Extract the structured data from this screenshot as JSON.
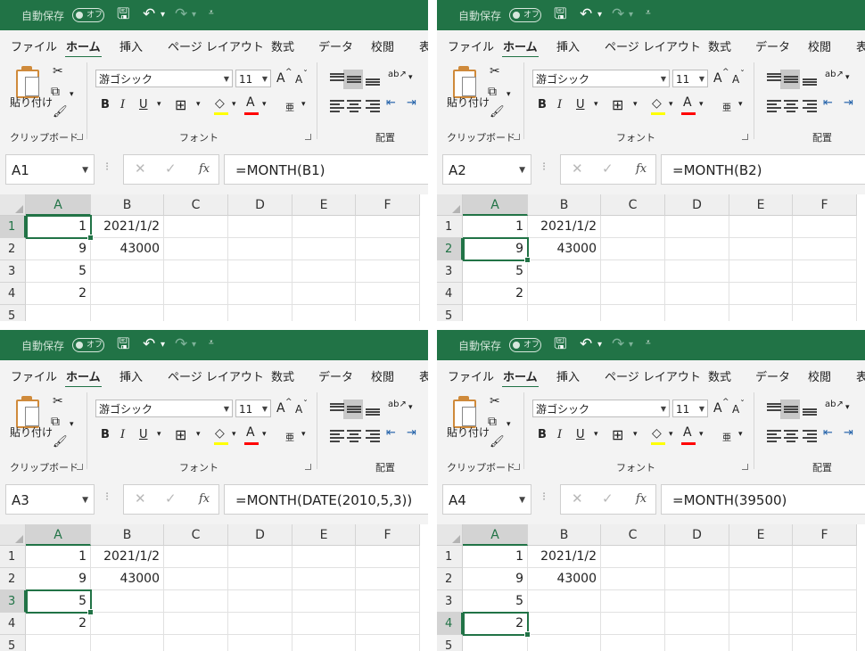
{
  "titlebar": {
    "autosave_label": "自動保存",
    "autosave_state": "オフ"
  },
  "tabs": [
    "ファイル",
    "ホーム",
    "挿入",
    "ページ レイアウト",
    "数式",
    "データ",
    "校閲",
    "表"
  ],
  "ribbon": {
    "paste_label": "貼り付け",
    "group_clipboard": "クリップボード",
    "group_font": "フォント",
    "group_alignment": "配置",
    "font_name": "游ゴシック",
    "font_size": "11",
    "grow_font": "A",
    "shrink_font": "A",
    "bold": "B",
    "italic": "I",
    "underline": "U",
    "phonetic": "亜",
    "highlight_color": "#ffff00",
    "font_color": "#ff0000"
  },
  "formula_bar": {
    "fx": "fx"
  },
  "columns": [
    "A",
    "B",
    "C",
    "D",
    "E",
    "F"
  ],
  "rows": [
    "1",
    "2",
    "3",
    "4",
    "5"
  ],
  "cells": [
    [
      "1",
      "2021/1/2"
    ],
    [
      "9",
      "43000"
    ],
    [
      "5",
      ""
    ],
    [
      "2",
      ""
    ]
  ],
  "panels": [
    {
      "name_box": "A1",
      "formula": "=MONTH(B1)",
      "active_row": 1
    },
    {
      "name_box": "A2",
      "formula": "=MONTH(B2)",
      "active_row": 2
    },
    {
      "name_box": "A3",
      "formula": "=MONTH(DATE(2010,5,3))",
      "active_row": 3
    },
    {
      "name_box": "A4",
      "formula": "=MONTH(39500)",
      "active_row": 4
    }
  ],
  "colors": {
    "excel_green": "#217346"
  }
}
